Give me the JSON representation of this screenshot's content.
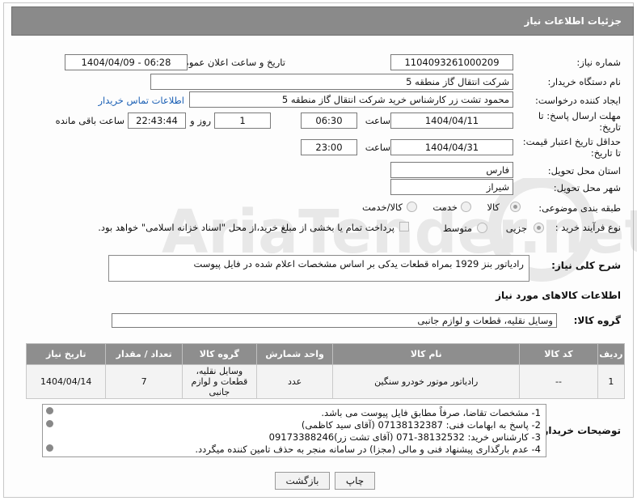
{
  "header": {
    "title": "جزئیات اطلاعات نیاز"
  },
  "fields": {
    "need_number_label": "شماره نیاز:",
    "need_number": "1104093261000209",
    "announce_label": "تاریخ و ساعت اعلان عمومی:",
    "announce_value": "1404/04/09 - 06:28",
    "buyer_org_label": "نام دستگاه خریدار:",
    "buyer_org": "شرکت انتقال گاز منطقه 5",
    "creator_label": "ایجاد کننده درخواست:",
    "creator": "محمود تشت زر کارشناس خرید شرکت انتقال گاز منطقه 5",
    "contact_link": "اطلاعات تماس خریدار",
    "deadline_label": "مهلت ارسال پاسخ: تا تاریخ:",
    "deadline_date": "1404/04/11",
    "time_label": "ساعت",
    "deadline_time": "06:30",
    "days_value": "1",
    "days_label": "روز و",
    "remaining_time": "22:43:44",
    "remaining_label": "ساعت باقی مانده",
    "validity_label": "حداقل تاریخ اعتبار قیمت: تا تاریخ:",
    "validity_date": "1404/04/31",
    "validity_time": "23:00",
    "province_label": "استان محل تحویل:",
    "province": "فارس",
    "city_label": "شهر محل تحویل:",
    "city": "شیراز",
    "category_label": "طبقه بندی موضوعی:",
    "category_options": [
      "کالا",
      "خدمت",
      "کالا/خدمت"
    ],
    "process_label": "نوع فرآیند خرید :",
    "process_options": [
      "جزیی",
      "متوسط"
    ],
    "payment_note": "پرداخت تمام یا بخشی از مبلغ خرید،از محل \"اسناد خزانه اسلامی\" خواهد بود.",
    "description_label": "شرح کلی نیاز:",
    "description": "رادیاتور بنز 1929 بمراه قطعات یدکی بر اساس مشخصات اعلام شده در فایل پیوست"
  },
  "goods_section": {
    "title": "اطلاعات کالاهای مورد نیاز",
    "group_label": "گروه کالا:",
    "group_value": "وسایل نقلیه، قطعات و لوازم جانبی"
  },
  "table": {
    "headers": [
      "ردیف",
      "کد کالا",
      "نام کالا",
      "واحد شمارش",
      "گروه کالا",
      "تعداد / مقدار",
      "تاریخ نیاز"
    ],
    "rows": [
      [
        "1",
        "--",
        "رادیاتور موتور خودرو سنگین",
        "عدد",
        "وسایل نقلیه، قطعات و لوازم جانبی",
        "7",
        "1404/04/14"
      ]
    ]
  },
  "notes": {
    "label": "توضیحات خریدار:",
    "lines": [
      "1-  مشخصات تقاضا، صرفاً مطابق فایل پیوست می باشد.",
      "2- پاسخ به ابهامات فنی: 07138132387 (آقای سید کاظمی)",
      "3- کارشناس خرید: 38132532-071 (آقای تشت زر)09173388246",
      "4- عدم بارگذاری پیشنهاد فنی و مالی (مجزا) در سامانه منجر به حذف تامین کننده میگردد."
    ]
  },
  "buttons": {
    "print": "چاپ",
    "back": "بازگشت"
  },
  "watermark": {
    "text": "AriaTender.net"
  }
}
